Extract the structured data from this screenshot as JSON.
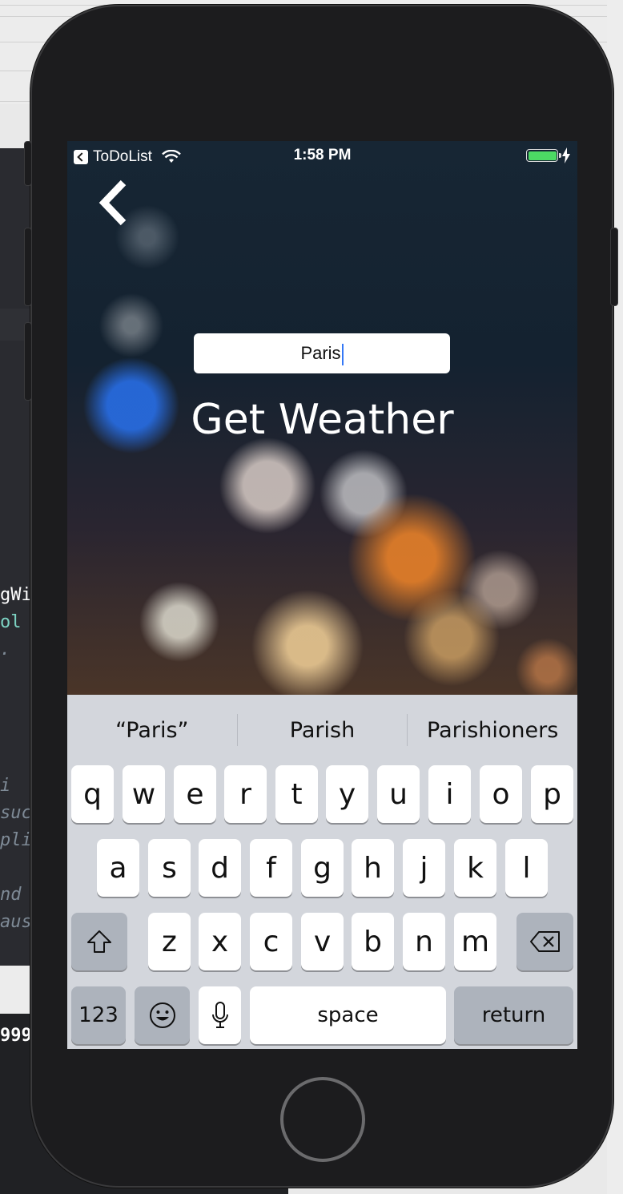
{
  "background_code": {
    "lines": [
      {
        "text": "gWi",
        "style": "w"
      },
      {
        "text": "ol",
        "style": "g"
      },
      {
        "text": ".",
        "style": "c"
      },
      {
        "text": "i",
        "style": "c"
      },
      {
        "text": "suc",
        "style": "c"
      },
      {
        "text": "pli",
        "style": "c"
      },
      {
        "text": "nd",
        "style": "c"
      },
      {
        "text": "aus",
        "style": "c"
      },
      {
        "text": "999",
        "style": "w"
      }
    ]
  },
  "status_bar": {
    "back_app": "ToDoList",
    "time": "1:58 PM",
    "battery_color": "#4cd964"
  },
  "nav": {
    "back_icon": "chevron-left-icon"
  },
  "city_field": {
    "value": "Paris"
  },
  "action": {
    "label": "Get Weather"
  },
  "keyboard": {
    "suggestions": [
      "“Paris”",
      "Parish",
      "Parishioners"
    ],
    "row1": [
      "q",
      "w",
      "e",
      "r",
      "t",
      "y",
      "u",
      "i",
      "o",
      "p"
    ],
    "row2": [
      "a",
      "s",
      "d",
      "f",
      "g",
      "h",
      "j",
      "k",
      "l"
    ],
    "row3": [
      "z",
      "x",
      "c",
      "v",
      "b",
      "n",
      "m"
    ],
    "numbers_label": "123",
    "space_label": "space",
    "return_label": "return"
  }
}
